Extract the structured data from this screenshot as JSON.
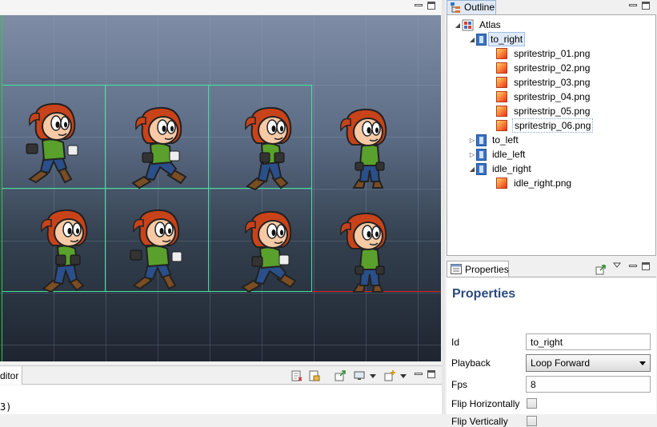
{
  "editor": {
    "console_tab_label": "ditor",
    "console_text": "3)"
  },
  "outline": {
    "tab_label": "Outline",
    "tree": {
      "root": "Atlas",
      "animations": [
        {
          "label": "to_right",
          "expanded": true,
          "images": [
            "spritestrip_01.png",
            "spritestrip_02.png",
            "spritestrip_03.png",
            "spritestrip_04.png",
            "spritestrip_05.png",
            "spritestrip_06.png"
          ]
        },
        {
          "label": "to_left",
          "expanded": false
        },
        {
          "label": "idle_left",
          "expanded": false
        },
        {
          "label": "idle_right",
          "expanded": true,
          "images": [
            "idle_right.png"
          ]
        }
      ]
    }
  },
  "properties": {
    "tab_label": "Properties",
    "title": "Properties",
    "id_label": "Id",
    "id_value": "to_right",
    "playback_label": "Playback",
    "playback_value": "Loop Forward",
    "fps_label": "Fps",
    "fps_value": "8",
    "flip_h_label": "Flip Horizontally",
    "flip_h_checked": false,
    "flip_v_label": "Flip Vertically",
    "flip_v_checked": false
  },
  "colors": {
    "frame_border": "#3fe6a0",
    "x_axis": "#e02020",
    "y_axis": "#2ecc40",
    "props_title": "#2b4a7d"
  },
  "icons": [
    "outline-icon",
    "atlas-icon",
    "animation-icon",
    "image-icon",
    "properties-icon",
    "pin-icon",
    "view-menu-icon",
    "minimize-icon",
    "maximize-icon"
  ]
}
